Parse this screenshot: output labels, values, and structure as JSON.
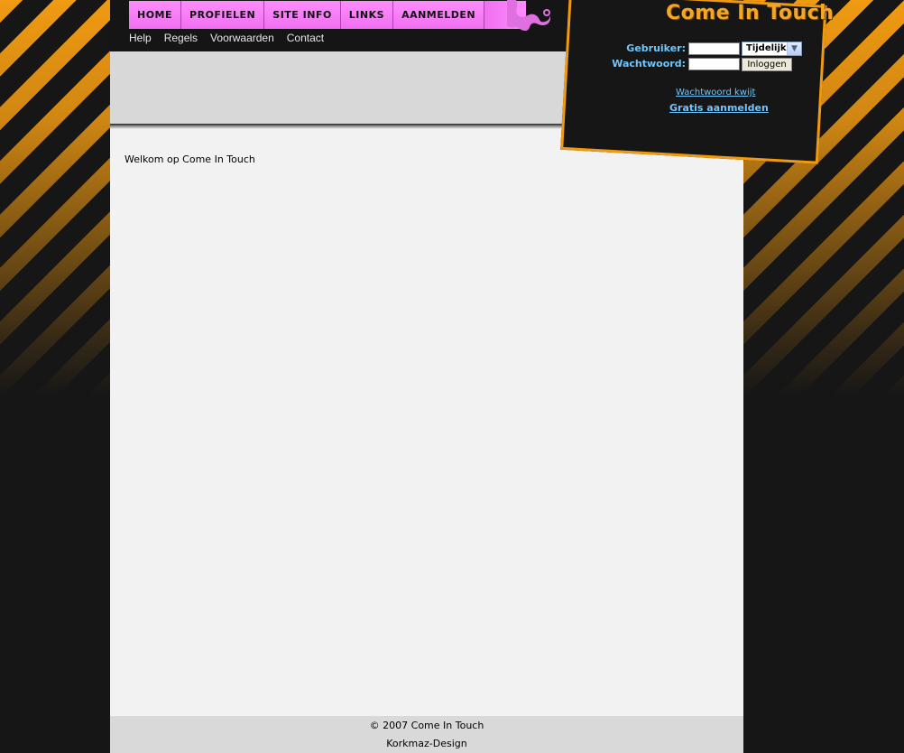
{
  "logo": {
    "text": "Come In Touch"
  },
  "main_nav": [
    {
      "label": "HOME"
    },
    {
      "label": "PROFIELEN"
    },
    {
      "label": "SITE INFO"
    },
    {
      "label": "LINKS"
    },
    {
      "label": "AANMELDEN"
    }
  ],
  "sub_nav": [
    {
      "label": "Help"
    },
    {
      "label": "Regels"
    },
    {
      "label": "Voorwaarden"
    },
    {
      "label": "Contact"
    }
  ],
  "login": {
    "user_label": "Gebruiker:",
    "password_label": "Wachtwoord:",
    "user_value": "",
    "password_value": "",
    "session_select": "Tijdelijk",
    "login_button": "Inloggen",
    "forgot_link": "Wachtwoord kwijt",
    "register_link": "Gratis aanmelden"
  },
  "content": {
    "welcome": "Welkom op Come In Touch"
  },
  "footer": {
    "copyright": "© 2007 Come In Touch",
    "credit": "Korkmaz-Design"
  },
  "colors": {
    "accent_orange": "#f09a12",
    "nav_pink": "#ff8cff",
    "link_blue": "#6ec6ff"
  }
}
